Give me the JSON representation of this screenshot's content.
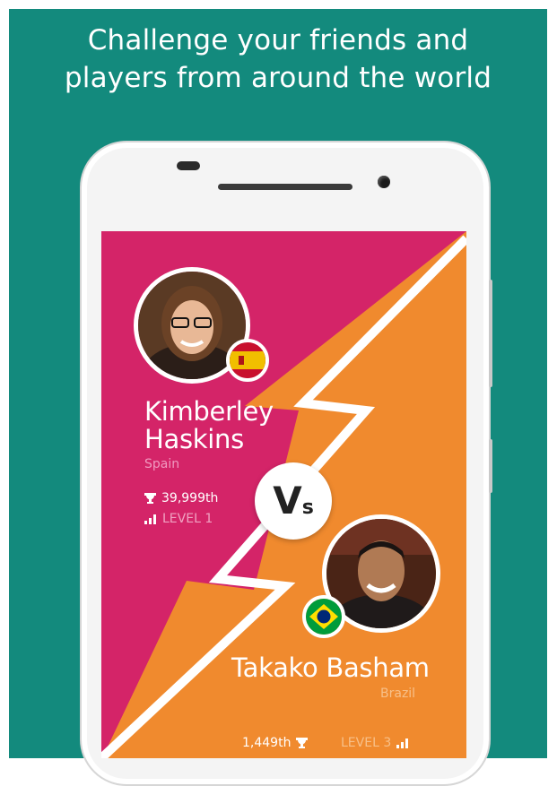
{
  "headline": {
    "line1": "Challenge your friends and",
    "line2": "players from around the world"
  },
  "colors": {
    "background": "#138a7d",
    "player1_panel": "#d42468",
    "player2_panel": "#f08a2e"
  },
  "versus": {
    "label_big": "V",
    "label_small": "s"
  },
  "player1": {
    "name_line1": "Kimberley",
    "name_line2": "Haskins",
    "country": "Spain",
    "flag_icon": "spain-flag-icon",
    "rank": "39,999th",
    "level": "LEVEL 1"
  },
  "player2": {
    "name": "Takako Basham",
    "country": "Brazil",
    "flag_icon": "brazil-flag-icon",
    "rank": "1,449th",
    "level": "LEVEL 3"
  }
}
